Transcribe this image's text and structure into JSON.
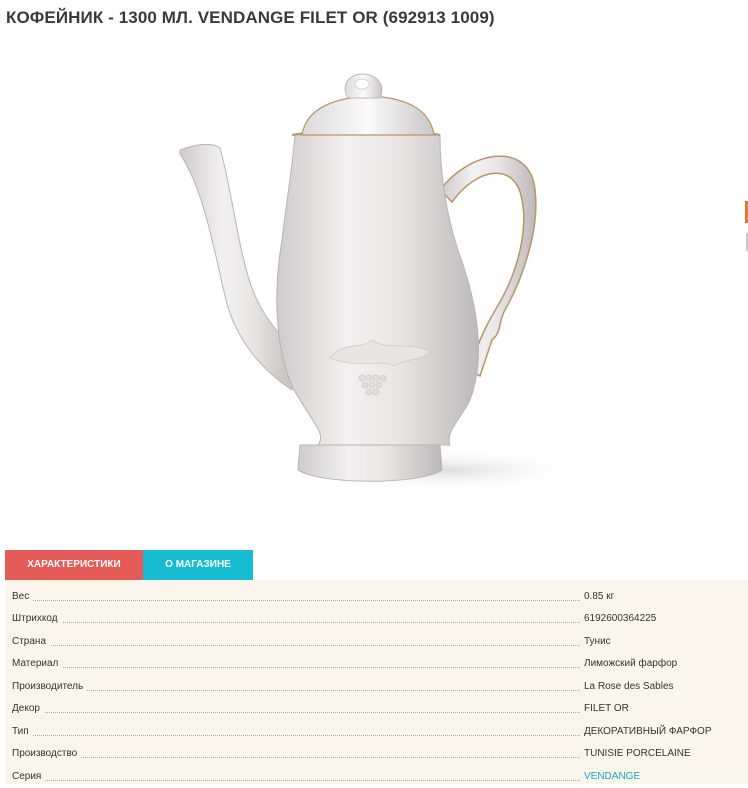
{
  "product": {
    "title": "КОФЕЙНИК - 1300 МЛ. VENDANGE FILET OR (692913 1009)",
    "image_alt": "coffee-pot-photo"
  },
  "tabs": [
    {
      "label": "ХАРАКТЕРИСТИКИ",
      "active": true,
      "color": "#e45b57"
    },
    {
      "label": "О МАГАЗИНЕ",
      "active": false,
      "color": "#17bcd0"
    }
  ],
  "specs": [
    {
      "label": "Вес",
      "value": "0.85 кг"
    },
    {
      "label": "Штрихкод",
      "value": "6192600364225"
    },
    {
      "label": "Страна",
      "value": "Тунис"
    },
    {
      "label": "Материал",
      "value": "Лиможский фарфор"
    },
    {
      "label": "Производитель",
      "value": "La Rose des Sables"
    },
    {
      "label": "Декор",
      "value": "FILET OR"
    },
    {
      "label": "Тип",
      "value": "ДЕКОРАТИВНЫЙ ФАРФОР"
    },
    {
      "label": "Производство",
      "value": "TUNISIE PORCELAINE"
    },
    {
      "label": "Серия",
      "value": "VENDANGE",
      "link": true
    }
  ],
  "colors": {
    "accent_red": "#e45b57",
    "accent_teal": "#17bcd0",
    "link": "#17a8bd",
    "specs_bg": "#fbf6eb",
    "gold_trim": "#b8956a"
  }
}
